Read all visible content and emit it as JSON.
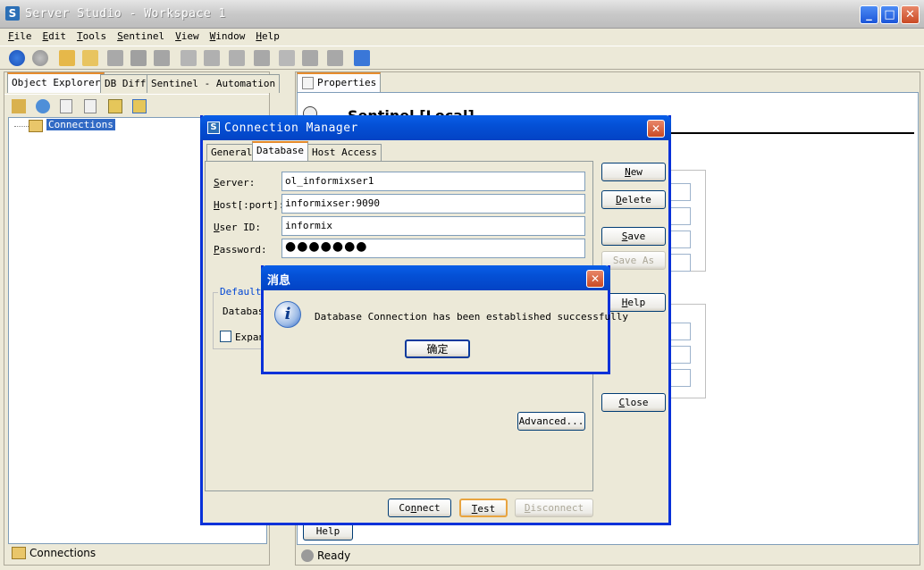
{
  "window": {
    "title": "Server Studio - Workspace 1",
    "app_icon": "S"
  },
  "menu": [
    {
      "label": "File",
      "u": "F",
      "rest": "ile"
    },
    {
      "label": "Edit",
      "u": "E",
      "rest": "dit"
    },
    {
      "label": "Tools",
      "u": "T",
      "rest": "ools"
    },
    {
      "label": "Sentinel",
      "u": "S",
      "rest": "entinel"
    },
    {
      "label": "View",
      "u": "V",
      "rest": "iew"
    },
    {
      "label": "Window",
      "u": "W",
      "rest": "indow"
    },
    {
      "label": "Help",
      "u": "H",
      "rest": "elp"
    }
  ],
  "left_panel": {
    "tabs": [
      "Object Explorer",
      "DB Diff",
      "Sentinel - Automation"
    ],
    "tree_root": "Connections",
    "status": "Connections"
  },
  "right_panel": {
    "tab": "Properties",
    "header_text": "Sentinel [Local]",
    "help_button": "Help",
    "status": "Ready"
  },
  "connection_manager": {
    "title": "Connection Manager",
    "title_icon": "S",
    "tabs": [
      "General",
      "Database",
      "Host Access"
    ],
    "fields": [
      {
        "label": "Server:",
        "u": "S",
        "value": "ol_informixser1"
      },
      {
        "label": "Host[:port]:",
        "u": "H",
        "value": "informixser:9090"
      },
      {
        "label": "User ID:",
        "u": "U",
        "value": "informix"
      },
      {
        "label": "Password:",
        "u": "P",
        "value": "●●●●●●●"
      }
    ],
    "group_label": "Default",
    "database_label": "Databas",
    "expand_label": "Expan",
    "advanced_button": "Advanced...",
    "side_buttons": {
      "new": "New",
      "delete": "Delete",
      "save": "Save",
      "save_as": "Save As",
      "help": "Help",
      "close": "Close"
    },
    "bottom_buttons": {
      "connect": "Connect",
      "test": "Test",
      "disconnect": "Disconnect"
    }
  },
  "message_box": {
    "title": "消息",
    "message": "Database Connection has been established successfully",
    "ok": "确定"
  }
}
